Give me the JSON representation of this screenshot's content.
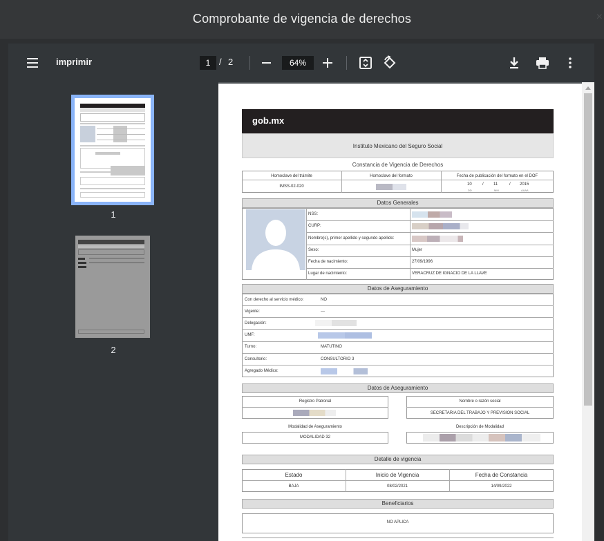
{
  "modal": {
    "title": "Comprobante de vigencia de derechos",
    "close": "×"
  },
  "toolbar": {
    "title": "imprimir",
    "current_page": "1",
    "page_sep": "/",
    "total_pages": "2",
    "zoom": "64%"
  },
  "thumbnails": [
    {
      "label": "1"
    },
    {
      "label": "2"
    }
  ],
  "document": {
    "logo": "gob.mx",
    "institution": "Instituto Mexicano del Seguro Social",
    "constancia_title": "Constancia de Vigencia de Derechos",
    "header_table": {
      "columns": [
        "Homoclave del trámite",
        "Homoclave del formato",
        "Fecha de publicación del formato en el DOF"
      ],
      "homoclave_tramite": "IMSS-02-020",
      "date": {
        "dd": "10",
        "mm": "11",
        "aaaa": "2015",
        "sep": "/",
        "dd_label": "DD",
        "mm_label": "MM",
        "aaaa_label": "AAAA"
      }
    },
    "datos_generales": {
      "title": "Datos Generales",
      "rows": [
        {
          "label": "NSS:",
          "value": ""
        },
        {
          "label": "CURP:",
          "value": ""
        },
        {
          "label": "Nombre(s), primer apellido y segundo apellido:",
          "value": ""
        },
        {
          "label": "Sexo:",
          "value": "Mujer"
        },
        {
          "label": "Fecha de nacimiento:",
          "value": "27/09/1996"
        },
        {
          "label": "Lugar de nacimiento:",
          "value": "VERACRUZ DE IGNACIO DE LA LLAVE"
        }
      ]
    },
    "datos_aseguramiento": {
      "title": "Datos de Aseguramiento",
      "rows": [
        {
          "label": "Con derecho al servicio médico:",
          "value": "NO"
        },
        {
          "label": "Vigente:",
          "value": "---"
        },
        {
          "label": "Delegación:",
          "value": ""
        },
        {
          "label": "UMF:",
          "value": ""
        },
        {
          "label": "Turno:",
          "value": "MATUTINO"
        },
        {
          "label": "Consultorio:",
          "value": "CONSULTORIO 3"
        },
        {
          "label": "Agregado Médico:",
          "value": ""
        }
      ]
    },
    "datos_aseguramiento_2": {
      "title": "Datos de Aseguramiento",
      "registro_patronal_label": "Registro Patronal",
      "razon_social_label": "Nombre o razón social",
      "razon_social_value": "SECRETARIA DEL TRABAJO Y PREVISION SOCIAL",
      "modalidad_label": "Modalidad de Aseguramiento",
      "modalidad_value": "MODALIDAD 32",
      "descripcion_label": "Descripción de Modalidad"
    },
    "detalle_vigencia": {
      "title": "Detalle de vigencia",
      "columns": [
        "Estado",
        "Inicio de Vigencia",
        "Fecha de Constancia"
      ],
      "values": [
        "BAJA",
        "08/02/2021",
        "14/09/2022"
      ]
    },
    "beneficiarios": {
      "title": "Beneficiarios",
      "value": "NO APLICA"
    }
  },
  "colors": {
    "toolbar_bg": "#323639",
    "viewer_bg": "#525659",
    "thumb_selected": "#8ab4f8",
    "logo_bar": "#231f20"
  }
}
